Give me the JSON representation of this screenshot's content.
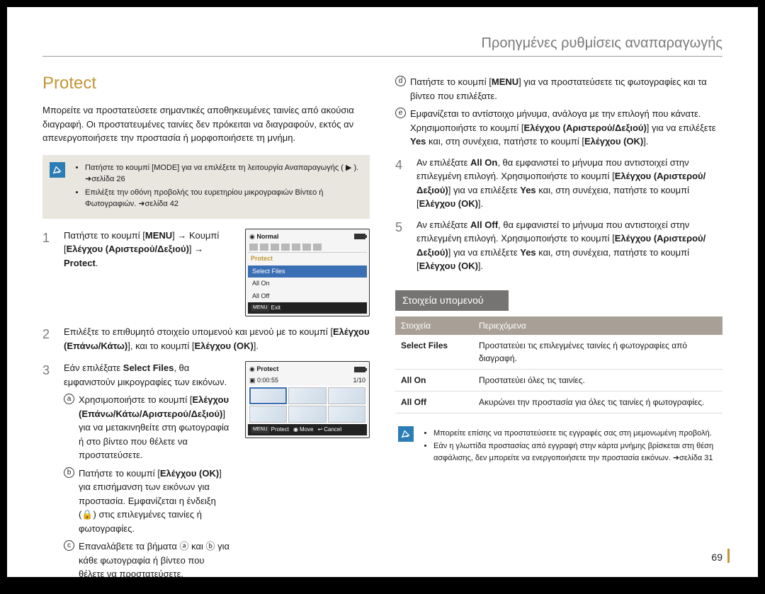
{
  "header": {
    "breadcrumb": "Προηγμένες ρυθμίσεις αναπαραγωγής"
  },
  "section": {
    "title": "Protect"
  },
  "intro": "Μπορείτε να προστατεύσετε σημαντικές αποθηκευμένες ταινίες από ακούσια διαγραφή. Οι προστατευμένες ταινίες δεν πρόκειται να διαγραφούν, εκτός αν απενεργοποιήσετε την προστασία ή μορφοποιήσετε τη μνήμη.",
  "note1": {
    "items": [
      "Πατήστε το κουμπί [MODE] για να επιλέξετε τη λειτουργία Αναπαραγωγής ( ▶ ). ➜σελίδα 26",
      "Επιλέξτε την οθόνη προβολής του ευρετηρίου μικρογραφιών Βίντεο ή Φωτογραφιών. ➜σελίδα 42"
    ]
  },
  "left_steps": {
    "s1": {
      "num": "1",
      "text_a": "Πατήστε το κουμπί [",
      "menu": "MENU",
      "text_b": "] → Κουμπί [",
      "ctrl": "Ελέγχου (Αριστερού/Δεξιού)",
      "text_c": "] → ",
      "protect": "Protect",
      "text_d": "."
    },
    "s2": {
      "num": "2",
      "text_a": "Επιλέξτε το επιθυμητό στοιχείο υπομενού και μενού με το κουμπί [",
      "ctrl": "Ελέγχου (Επάνω/Κάτω)",
      "text_b": "], και το κουμπί [",
      "ok": "Ελέγχου (OK)",
      "text_c": "]."
    },
    "s3": {
      "num": "3",
      "text_a": "Εάν επιλέξατε ",
      "sf": "Select Files",
      "text_b": ", θα εμφανιστούν μικρογραφίες των εικόνων.",
      "a": {
        "tag": "ⓐ",
        "text_a": "Χρησιμοποιήστε το κουμπί [",
        "ctrl": "Ελέγχου (Επάνω/Κάτω/Αριστερού/Δεξιού)",
        "text_b": "] για να μετακινηθείτε στη φωτογραφία ή στο βίντεο που θέλετε να προστατεύσετε."
      },
      "b": {
        "tag": "ⓑ",
        "text_a": "Πατήστε το κουμπί [",
        "ok": "Ελέγχου (OK)",
        "text_b": "] για επισήμανση των εικόνων για προστασία. Εμφανίζεται η ένδειξη (🔒) στις επιλεγμένες ταινίες ή φωτογραφίες."
      },
      "c": {
        "tag": "ⓒ",
        "text": "Επαναλάβετε τα βήματα ⓐ και ⓑ για κάθε φωτογραφία ή βίντεο που θέλετε να προστατεύσετε."
      }
    }
  },
  "right_sub": {
    "d": {
      "tag": "ⓓ",
      "text_a": "Πατήστε το κουμπί [",
      "menu": "MENU",
      "text_b": "] για να προστατεύσετε τις φωτογραφίες και τα βίντεο που επιλέξατε."
    },
    "e": {
      "tag": "ⓔ",
      "text_a": "Εμφανίζεται το αντίστοιχο μήνυμα, ανάλογα με την επιλογή που κάνατε. Χρησιμοποιήστε το κουμπί [",
      "ctrl": "Ελέγχου (Αριστερού/Δεξιού)",
      "text_b": "] για να επιλέξετε ",
      "yes": "Yes",
      "text_c": " και, στη συνέχεια, πατήστε το κουμπί [",
      "ok": "Ελέγχου (OK)",
      "text_d": "]."
    }
  },
  "right_steps": {
    "s4": {
      "num": "4",
      "text_a": "Αν επιλέξατε ",
      "allon": "All On",
      "text_b": ", θα εμφανιστεί το μήνυμα που αντιστοιχεί στην επιλεγμένη επιλογή. Χρησιμοποιήστε το κουμπί [",
      "ctrl": "Ελέγχου (Αριστερού/Δεξιού)",
      "text_c": "] για να επιλέξετε ",
      "yes": "Yes",
      "text_d": " και, στη συνέχεια, πατήστε το κουμπί [",
      "ok": "Ελέγχου (OK)",
      "text_e": "]."
    },
    "s5": {
      "num": "5",
      "text_a": "Αν επιλέξατε ",
      "alloff": "All Off",
      "text_b": ", θα εμφανιστεί το μήνυμα που αντιστοιχεί στην επιλεγμένη επιλογή. Χρησιμοποιήστε το κουμπί [",
      "ctrl": "Ελέγχου (Αριστερού/Δεξιού)",
      "text_c": "] για να επιλέξετε ",
      "yes": "Yes",
      "text_d": " και, στη συνέχεια, πατήστε το κουμπί [",
      "ok": "Ελέγχου (OK)",
      "text_e": "]."
    }
  },
  "ss1": {
    "normal": "Normal",
    "protect": "Protect",
    "select_files": "Select Files",
    "all_on": "All On",
    "all_off": "All Off",
    "menu": "MENU",
    "exit": "Exit"
  },
  "ss2": {
    "protect": "Protect",
    "time": "0:00:55",
    "count": "1/10",
    "menu": "MENU",
    "protect2": "Protect",
    "move": "Move",
    "cancel": "Cancel"
  },
  "subheading": "Στοιχεία υπομενού",
  "table": {
    "h1": "Στοιχεία",
    "h2": "Περιεχόμενα",
    "rows": [
      {
        "k": "Select Files",
        "v": "Προστατεύει τις επιλεγμένες ταινίες ή φωτογραφίες από διαγραφή."
      },
      {
        "k": "All On",
        "v": "Προστατεύει όλες τις ταινίες."
      },
      {
        "k": "All Off",
        "v": "Ακυρώνει την προστασία για όλες τις ταινίες ή φωτογραφίες."
      }
    ]
  },
  "note2": {
    "items": [
      "Μπορείτε επίσης να προστατεύσετε τις εγγραφές σας στη μεμονωμένη προβολή.",
      "Εάν η γλωττίδα προστασίας από εγγραφή στην κάρτα μνήμης βρίσκεται στη θέση ασφάλισης, δεν μπορείτε να ενεργοποιήσετε την προστασία εικόνων. ➜σελίδα 31"
    ]
  },
  "pagenum": "69"
}
